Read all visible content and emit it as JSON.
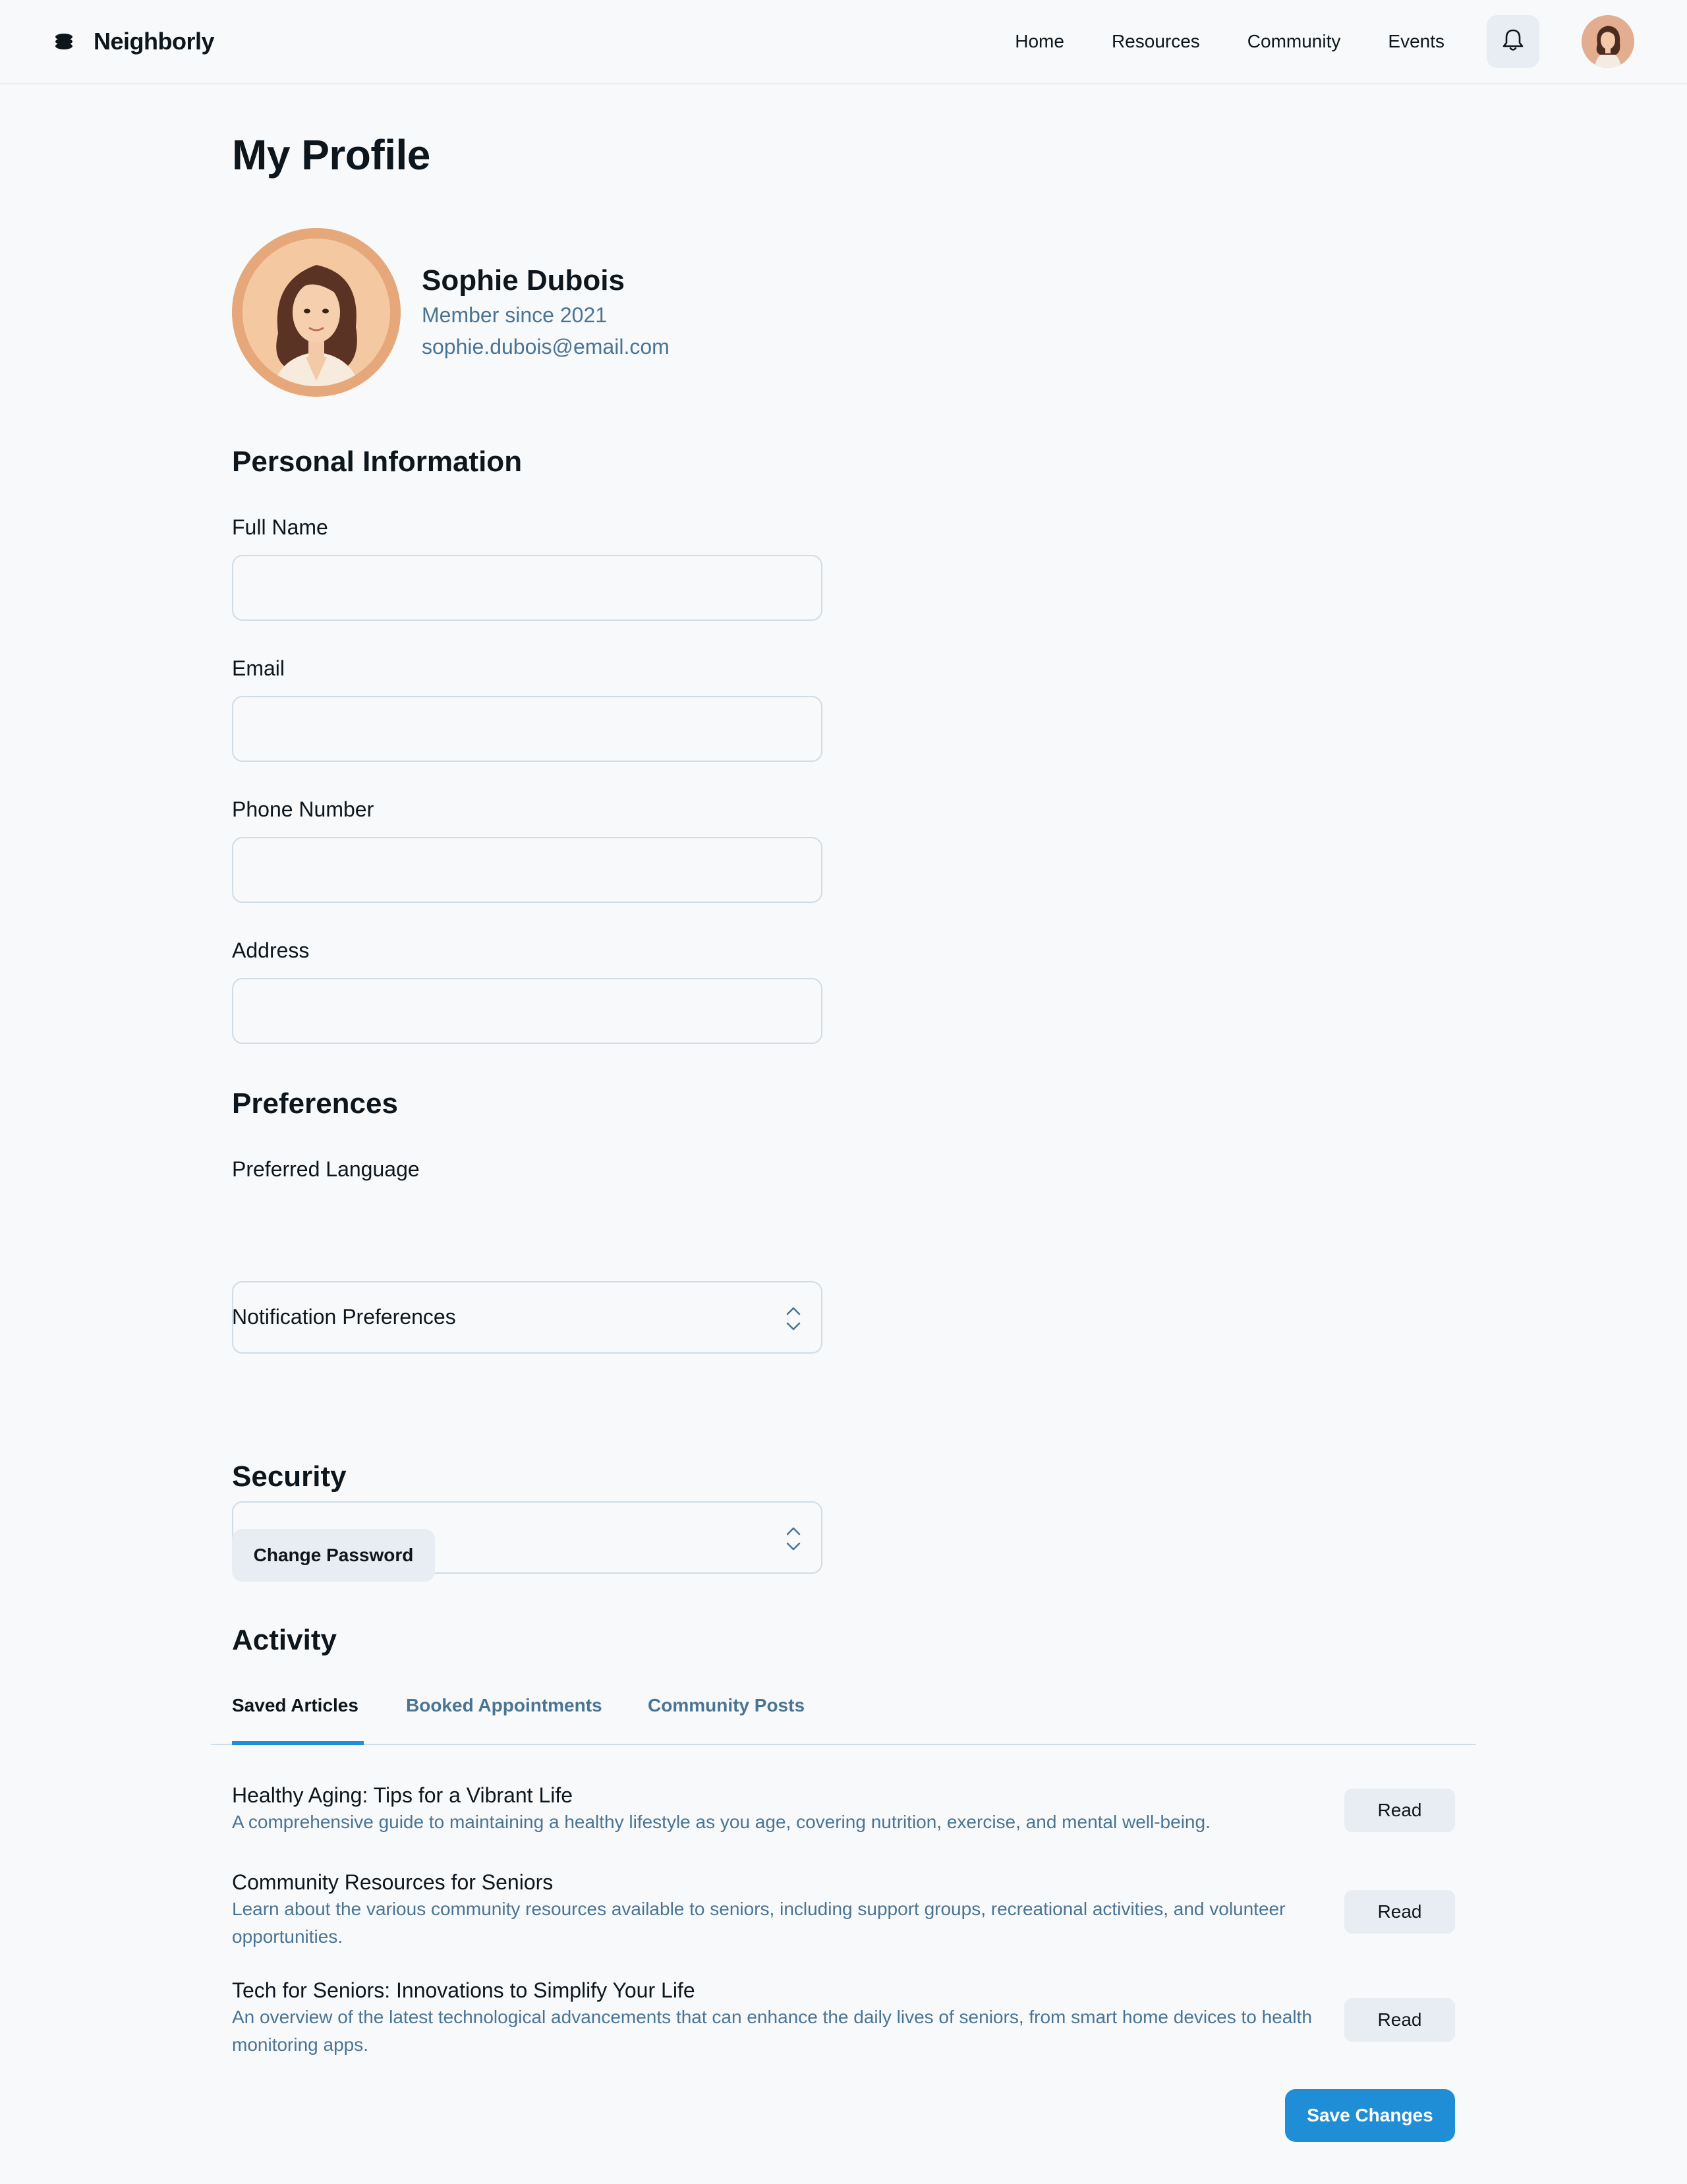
{
  "app": {
    "name": "Neighborly"
  },
  "nav": {
    "items": [
      "Home",
      "Resources",
      "Community",
      "Events"
    ]
  },
  "page": {
    "title": "My Profile"
  },
  "profile": {
    "name": "Sophie Dubois",
    "member_since": "Member since 2021",
    "email": "sophie.dubois@email.com"
  },
  "personal": {
    "title": "Personal Information",
    "fields": [
      {
        "label": "Full Name",
        "value": "",
        "placeholder": ""
      },
      {
        "label": "Email",
        "value": "",
        "placeholder": ""
      },
      {
        "label": "Phone Number",
        "value": "",
        "placeholder": ""
      },
      {
        "label": "Address",
        "value": "",
        "placeholder": ""
      }
    ]
  },
  "preferences": {
    "title": "Preferences",
    "fields": [
      {
        "label": "Preferred Language",
        "value": ""
      },
      {
        "label": "Notification Preferences",
        "value": ""
      }
    ]
  },
  "security": {
    "title": "Security",
    "change_password": "Change Password"
  },
  "activity": {
    "title": "Activity",
    "tabs": [
      "Saved Articles",
      "Booked Appointments",
      "Community Posts"
    ],
    "active_tab": "Saved Articles",
    "articles": [
      {
        "title": "Healthy Aging: Tips for a Vibrant Life",
        "description": "A comprehensive guide to maintaining a healthy lifestyle as you age, covering nutrition, exercise, and mental well-being.",
        "action": "Read"
      },
      {
        "title": "Community Resources for Seniors",
        "description": "Learn about the various community resources available to seniors, including support groups, recreational activities, and volunteer opportunities.",
        "action": "Read"
      },
      {
        "title": "Tech for Seniors: Innovations to Simplify Your Life",
        "description": "An overview of the latest technological advancements that can enhance the daily lives of seniors, from smart home devices to health monitoring apps.",
        "action": "Read"
      }
    ]
  },
  "actions": {
    "save": "Save Changes"
  },
  "colors": {
    "accent": "#1f8ed6",
    "muted_text": "#4a7494",
    "button_bg": "#e7edf2",
    "border": "#d0dce6"
  }
}
